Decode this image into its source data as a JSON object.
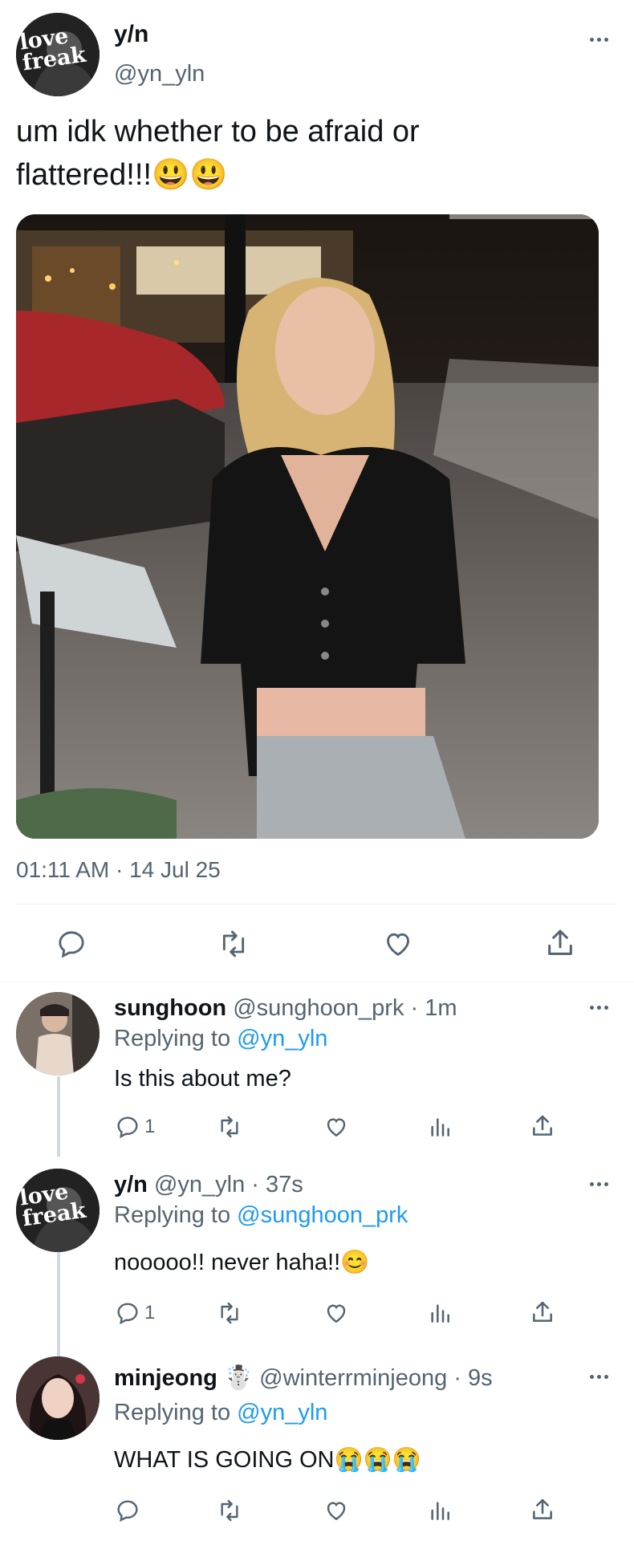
{
  "main_tweet": {
    "display_name": "y/n",
    "handle": "@yn_yln",
    "avatar_text": "love freak",
    "text_line1": "um idk whether to be afraid or",
    "text_line2": "flattered!!!😃😃",
    "timestamp": "01:11 AM · 14 Jul 25"
  },
  "replies": [
    {
      "name": "sunghoon",
      "meta": "@sunghoon_prk · 1m",
      "replying_prefix": "Replying to",
      "replying_to": "@yn_yln",
      "text": "Is this about me?",
      "reply_count": "1"
    },
    {
      "name": "y/n",
      "meta": "@yn_yln · 37s",
      "replying_prefix": "Replying to",
      "replying_to": "@sunghoon_prk",
      "text": "nooooo!! never haha!!😊",
      "reply_count": "1",
      "avatar_text": "love freak"
    },
    {
      "name": "minjeong ☃️",
      "meta": "@winterrminjeong · 9s",
      "replying_prefix": "Replying to",
      "replying_to": "@yn_yln",
      "text": "WHAT IS GOING ON😭😭😭",
      "reply_count": ""
    }
  ],
  "colors": {
    "accent": "#1d9bf0",
    "muted": "#536471",
    "divider": "#eff3f4"
  },
  "icons": [
    "reply-icon",
    "retweet-icon",
    "like-icon",
    "views-icon",
    "share-icon",
    "more-icon"
  ]
}
